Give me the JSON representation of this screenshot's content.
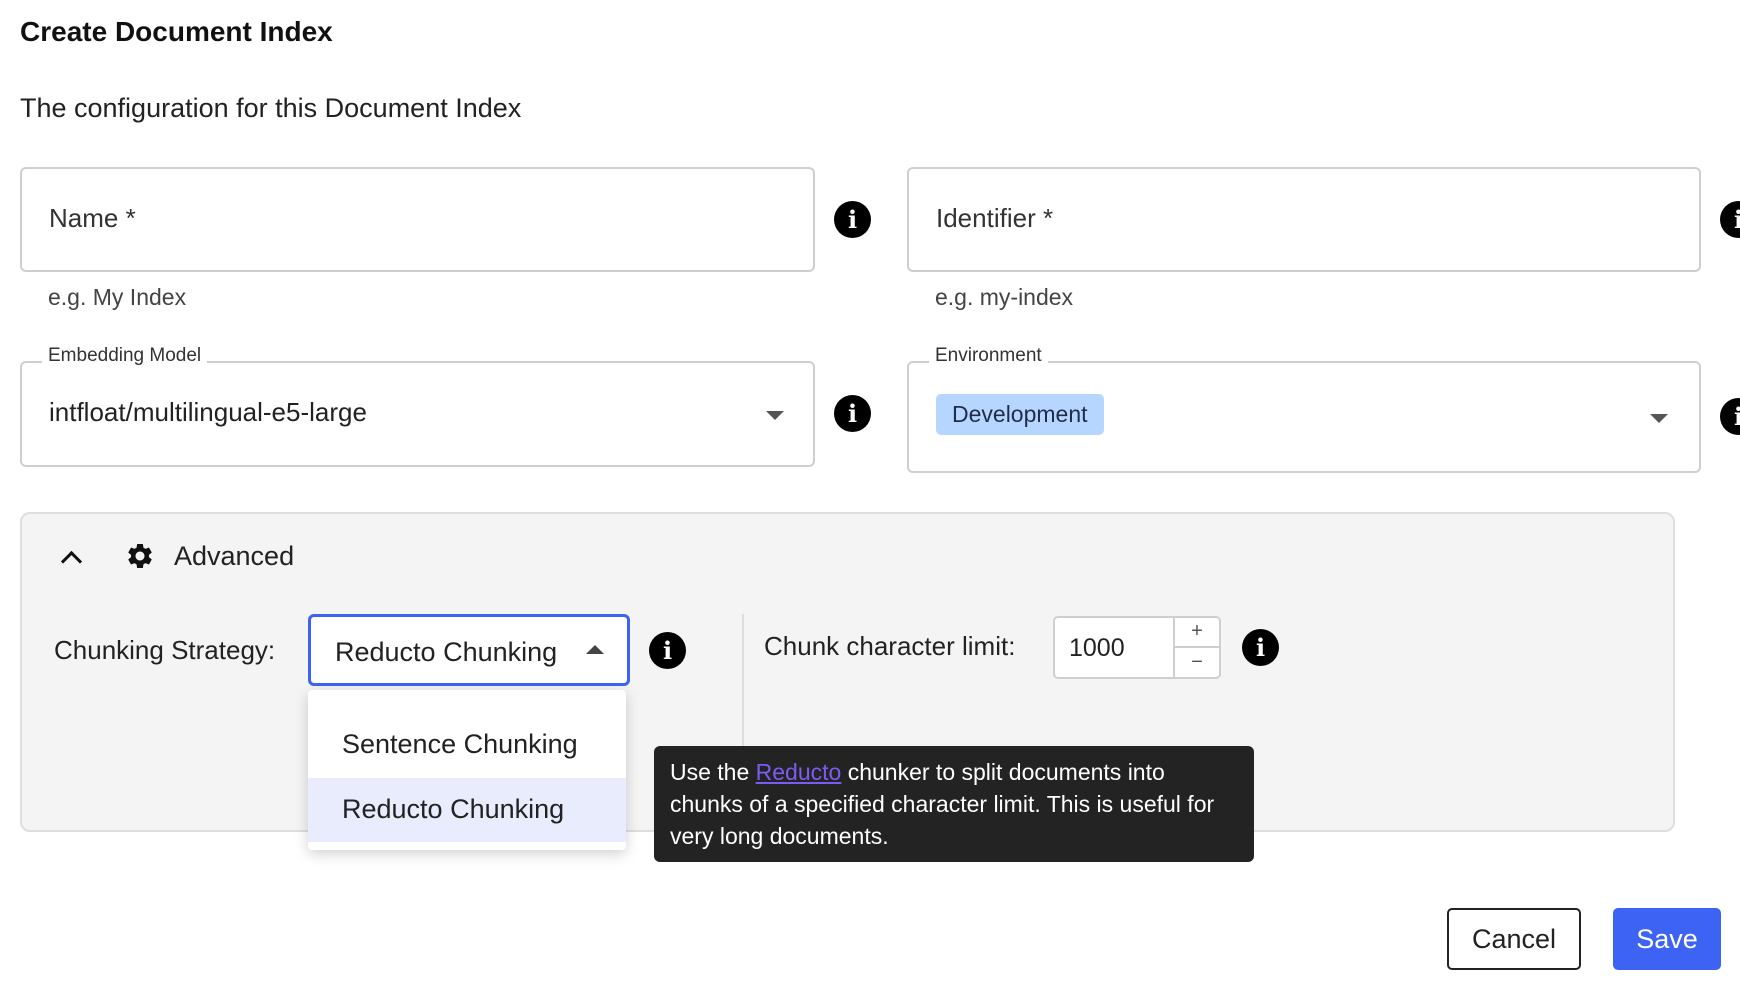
{
  "header": {
    "title": "Create Document Index",
    "subtitle": "The configuration for this Document Index"
  },
  "form": {
    "name": {
      "label": "Name *",
      "helper": "e.g. My Index",
      "value": ""
    },
    "identifier": {
      "label": "Identifier *",
      "helper": "e.g. my-index",
      "value": ""
    },
    "embedding_model": {
      "legend": "Embedding Model",
      "value": "intfloat/multilingual-e5-large"
    },
    "environment": {
      "legend": "Environment",
      "value": "Development"
    }
  },
  "advanced": {
    "label": "Advanced",
    "expanded": true,
    "chunking_strategy": {
      "label": "Chunking Strategy:",
      "selected": "Reducto Chunking",
      "options": [
        "Sentence Chunking",
        "Reducto Chunking"
      ]
    },
    "chunk_limit": {
      "label": "Chunk character limit:",
      "value": "1000",
      "increment": "+",
      "decrement": "−"
    }
  },
  "tooltip": {
    "prefix": "Use the ",
    "link_text": "Reducto",
    "suffix": " chunker to split documents into chunks of a specified character limit. This is useful for very long documents."
  },
  "actions": {
    "cancel_label": "Cancel",
    "save_label": "Save"
  },
  "icons": {
    "info": "info-icon",
    "settings": "gear-icon",
    "collapse": "chevron-up-icon",
    "dropdown": "caret-down-icon"
  },
  "colors": {
    "accent": "#3d63f5",
    "chip_background": "#b7d6ff",
    "tooltip_background": "#232323",
    "link": "#7c5cf0"
  }
}
